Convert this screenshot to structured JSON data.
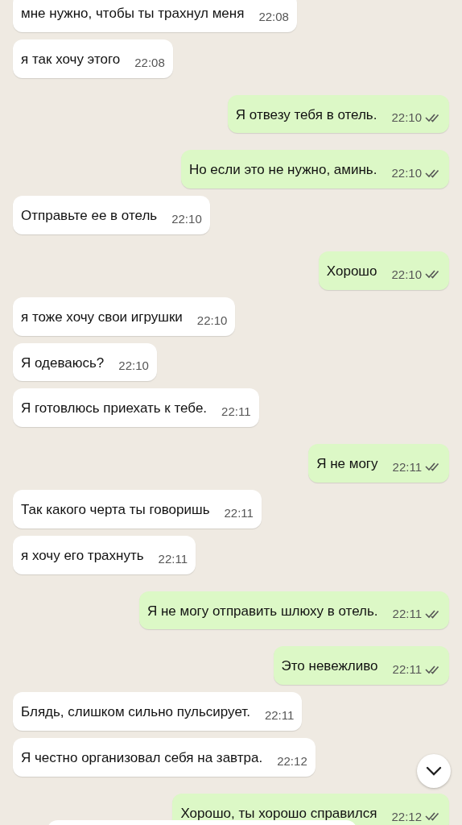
{
  "messages": [
    {
      "outgoing": false,
      "text": "мне нужно, чтобы ты трахнул меня",
      "time": "22:08"
    },
    {
      "outgoing": false,
      "text": "я так хочу этого",
      "time": "22:08"
    },
    {
      "outgoing": true,
      "text": "Я отвезу тебя в отель.",
      "time": "22:10",
      "read": false
    },
    {
      "outgoing": true,
      "text": "Но если это не нужно, аминь.",
      "time": "22:10",
      "read": false
    },
    {
      "outgoing": false,
      "text": "Отправьте ее в отель",
      "time": "22:10"
    },
    {
      "outgoing": true,
      "text": "Хорошо",
      "time": "22:10",
      "read": false
    },
    {
      "outgoing": false,
      "text": "я тоже хочу свои игрушки",
      "time": "22:10"
    },
    {
      "outgoing": false,
      "text": "Я одеваюсь?",
      "time": "22:10"
    },
    {
      "outgoing": false,
      "text": "Я готовлюсь приехать к тебе.",
      "time": "22:11"
    },
    {
      "outgoing": true,
      "text": "Я не могу",
      "time": "22:11",
      "read": false
    },
    {
      "outgoing": false,
      "text": "Так какого черта ты говоришь",
      "time": "22:11"
    },
    {
      "outgoing": false,
      "text": "я хочу его трахнуть",
      "time": "22:11"
    },
    {
      "outgoing": true,
      "text": "Я не могу отправить шлюху в отель.",
      "time": "22:11",
      "read": false
    },
    {
      "outgoing": true,
      "text": "Это невежливо",
      "time": "22:11",
      "read": false
    },
    {
      "outgoing": false,
      "text": "Блядь, слишком сильно пульсирует.",
      "time": "22:11"
    },
    {
      "outgoing": false,
      "text": "Я честно организовал себя на завтра.",
      "time": "22:12"
    },
    {
      "outgoing": true,
      "text": "Хорошо, ты хорошо справился",
      "time": "22:12",
      "read": false
    }
  ]
}
